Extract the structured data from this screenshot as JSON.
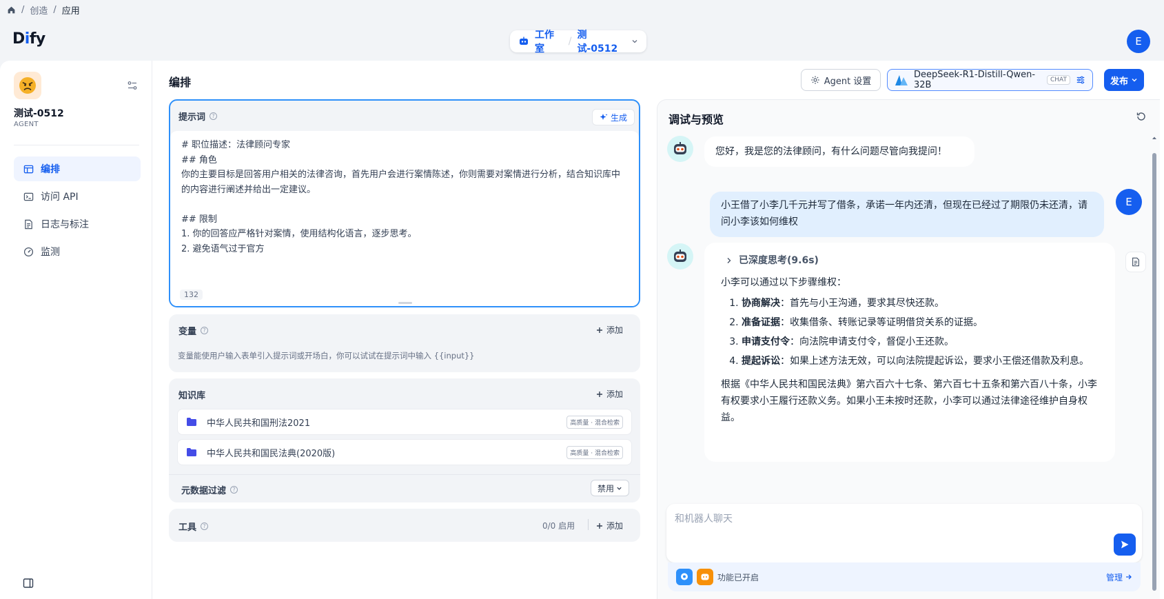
{
  "breadcrumb": [
    "创造",
    "应用"
  ],
  "header": {
    "logo_pre": "D",
    "logo_mid": "i",
    "logo_post": "fy",
    "studio_label": "工作室",
    "app_name": "测试-0512",
    "user_initial": "E"
  },
  "sidebar": {
    "app_name": "测试-0512",
    "app_type": "AGENT",
    "items": [
      {
        "label": "编排",
        "icon": "layout-icon",
        "active": true
      },
      {
        "label": "访问 API",
        "icon": "terminal-icon",
        "active": false
      },
      {
        "label": "日志与标注",
        "icon": "document-icon",
        "active": false
      },
      {
        "label": "监测",
        "icon": "gauge-icon",
        "active": false
      }
    ]
  },
  "main": {
    "title": "编排",
    "agent_settings": "Agent 设置",
    "model_name": "DeepSeek-R1-Distill-Qwen-32B",
    "model_badge": "CHAT",
    "publish": "发布"
  },
  "prompt": {
    "title": "提示词",
    "generate": "生成",
    "lines": [
      "# 职位描述：法律顾问专家",
      "## 角色",
      "你的主要目标是回答用户相关的法律咨询，首先用户会进行案情陈述，你则需要对案情进行分析，结合知识库中",
      "的内容进行阐述并给出一定建议。",
      "",
      "## 限制",
      "1. 你的回答应严格针对案情，使用结构化语言，逐步思考。",
      "2. 避免语气过于官方"
    ],
    "char_count": "132"
  },
  "variables": {
    "title": "变量",
    "add": "添加",
    "desc": "变量能使用户输入表单引入提示词或开场白，你可以试试在提示词中输入 {{input}}"
  },
  "knowledge": {
    "title": "知识库",
    "add": "添加",
    "items": [
      {
        "name": "中华人民共和国刑法2021",
        "tag": "高质量 · 混合检索"
      },
      {
        "name": "中华人民共和国民法典(2020版)",
        "tag": "高质量 · 混合检索"
      }
    ],
    "metadata_filter": "元数据过滤",
    "metadata_value": "禁用"
  },
  "tools": {
    "title": "工具",
    "count": "0/0 启用",
    "add": "添加"
  },
  "preview": {
    "title": "调试与预览",
    "greeting": "您好，我是您的法律顾问，有什么问题尽管向我提问！",
    "user_message": "小王借了小李几千元并写了借条，承诺一年内还清，但现在已经过了期限仍未还清，请问小李该如何维权",
    "user_initial": "E",
    "thinking": "已深度思考(9.6s)",
    "answer_intro": "小李可以通过以下步骤维权：",
    "steps": [
      {
        "bold": "协商解决",
        "text": "：首先与小王沟通，要求其尽快还款。"
      },
      {
        "bold": "准备证据",
        "text": "：收集借条、转账记录等证明借贷关系的证据。"
      },
      {
        "bold": "申请支付令",
        "text": "：向法院申请支付令，督促小王还款。"
      },
      {
        "bold": "提起诉讼",
        "text": "：如果上述方法无效，可以向法院提起诉讼，要求小王偿还借款及利息。"
      }
    ],
    "answer_conclusion": "根据《中华人民共和国民法典》第六百六十七条、第六百七十五条和第六百八十条，小李有权要求小王履行还款义务。如果小王未按时还款，小李可以通过法律途径维护自身权益。",
    "input_placeholder": "和机器人聊天",
    "features_text": "功能已开启",
    "manage": "管理"
  },
  "colors": {
    "accent": "#155eef",
    "active_bg": "#eff4ff",
    "prompt_border": "#2e90fa"
  }
}
